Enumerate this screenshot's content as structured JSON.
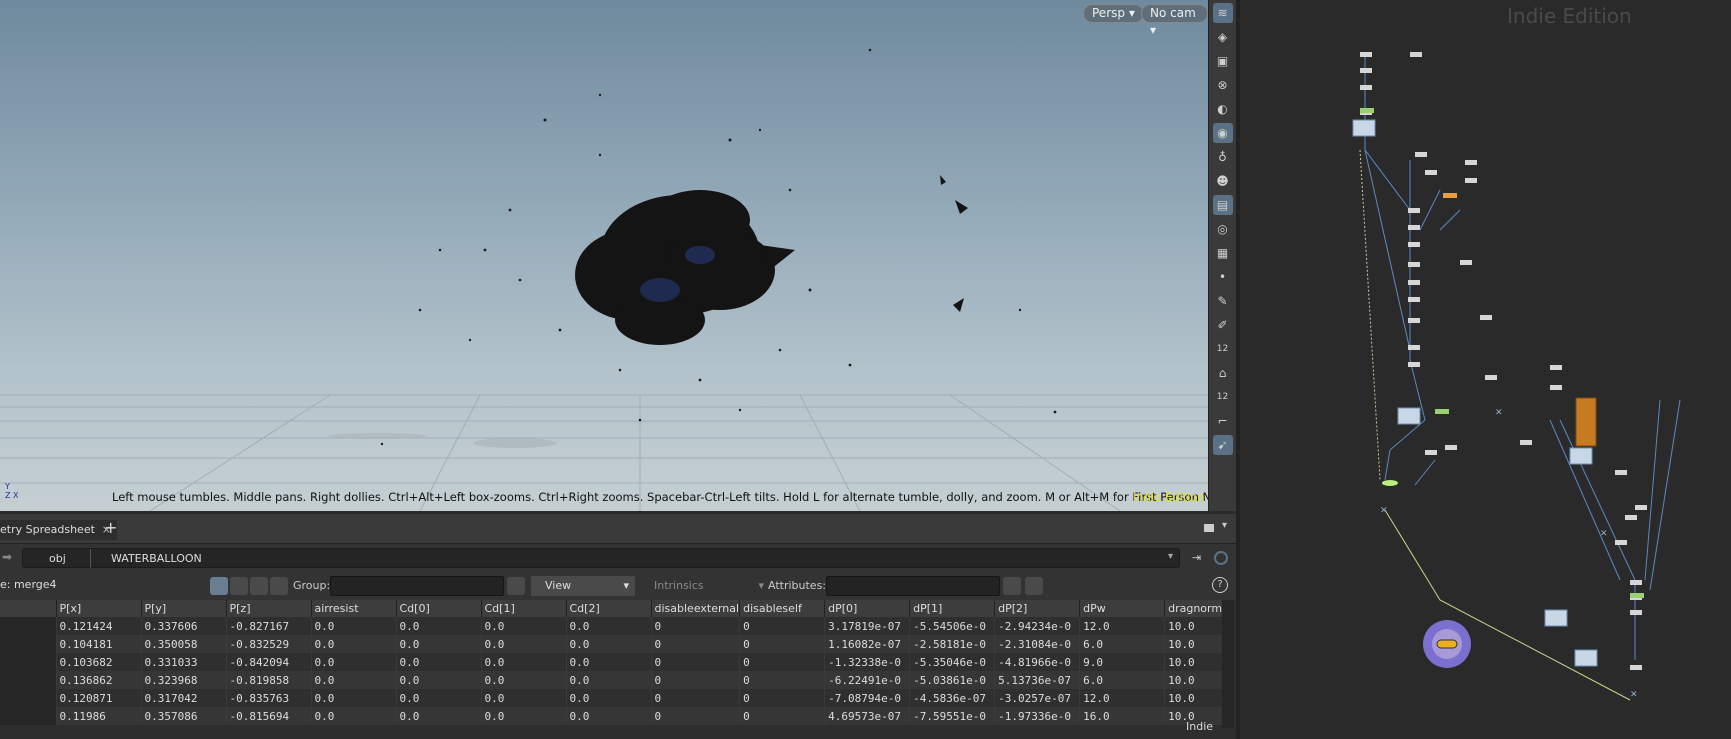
{
  "viewport": {
    "camera_mode": "Persp",
    "camera_menu": "No cam",
    "hint": "Left mouse tumbles. Middle pans. Right dollies. Ctrl+Alt+Left box-zooms. Ctrl+Right zooms. Spacebar-Ctrl-Left tilts. Hold L for alternate tumble, dolly, and zoom.    M or Alt+M for First Person Navigation.",
    "edition": "Indie Edition",
    "toolbar_numbers": [
      "12",
      "12"
    ]
  },
  "spreadsheet": {
    "tab_title": "etry Spreadsheet",
    "path": {
      "root": "obj",
      "geo": "WATERBALLOON"
    },
    "node_label": "e: merge4",
    "group_label": "Group:",
    "view_label": "View",
    "intrinsics_label": "Intrinsics",
    "attributes_label": "Attributes:",
    "help": "?",
    "indie_tag": "Indie",
    "columns": [
      "P[x]",
      "P[y]",
      "P[z]",
      "airresist",
      "Cd[0]",
      "Cd[1]",
      "Cd[2]",
      "disableexternal",
      "disableself",
      "dP[0]",
      "dP[1]",
      "dP[2]",
      "dPw",
      "dragnorma"
    ],
    "rows": [
      [
        "0.121424",
        "0.337606",
        "-0.827167",
        "0.0",
        "0.0",
        "0.0",
        "0.0",
        "0",
        "0",
        "3.17819e-07",
        "-5.54506e-0",
        "-2.94234e-0",
        "12.0",
        "10.0"
      ],
      [
        "0.104181",
        "0.350058",
        "-0.832529",
        "0.0",
        "0.0",
        "0.0",
        "0.0",
        "0",
        "0",
        "1.16082e-07",
        "-2.58181e-0",
        "-2.31084e-0",
        "6.0",
        "10.0"
      ],
      [
        "0.103682",
        "0.331033",
        "-0.842094",
        "0.0",
        "0.0",
        "0.0",
        "0.0",
        "0",
        "0",
        "-1.32338e-0",
        "-5.35046e-0",
        "-4.81966e-0",
        "9.0",
        "10.0"
      ],
      [
        "0.136862",
        "0.323968",
        "-0.819858",
        "0.0",
        "0.0",
        "0.0",
        "0.0",
        "0",
        "0",
        "-6.22491e-0",
        "-5.03861e-0",
        "5.13736e-07",
        "6.0",
        "10.0"
      ],
      [
        "0.120871",
        "0.317042",
        "-0.835763",
        "0.0",
        "0.0",
        "0.0",
        "0.0",
        "0",
        "0",
        "-7.08794e-0",
        "-4.5836e-07",
        "-3.0257e-07",
        "12.0",
        "10.0"
      ],
      [
        "0.11986",
        "0.357086",
        "-0.815694",
        "0.0",
        "0.0",
        "0.0",
        "0.0",
        "0",
        "0",
        "4.69573e-07",
        "-7.59551e-0",
        "-1.97336e-0",
        "16.0",
        "10.0"
      ]
    ]
  },
  "network": {
    "edition": "Indie Edition"
  },
  "colors": {
    "accent": "#5b7286",
    "indie_yellow": "#e6e020",
    "node_orange": "#e8a030",
    "selected_purple": "#6a5fc0"
  }
}
